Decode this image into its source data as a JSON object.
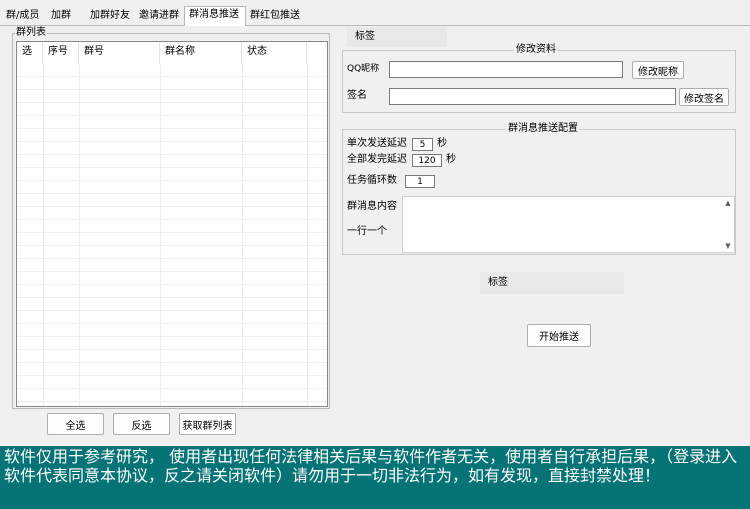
{
  "tabs": [
    {
      "label": "群/成员"
    },
    {
      "label": "加群"
    },
    {
      "label": "加群好友"
    },
    {
      "label": "邀请进群"
    },
    {
      "label": "群消息推送",
      "active": true
    },
    {
      "label": "群红包推送"
    }
  ],
  "group_list": {
    "title": "群列表",
    "columns": [
      "选",
      "序号",
      "群号",
      "群名称",
      "状态"
    ],
    "buttons": {
      "select_all": "全选",
      "invert": "反选",
      "fetch": "获取群列表"
    }
  },
  "right": {
    "tag_top": "标签",
    "profile": {
      "title": "修改资料",
      "nick_label": "QQ昵称",
      "nick_value": "",
      "nick_button": "修改昵称",
      "sign_label": "签名",
      "sign_value": "",
      "sign_button": "修改签名"
    },
    "config": {
      "title": "群消息推送配置",
      "single_delay_label": "单次发送延迟",
      "single_delay_value": "5",
      "single_delay_unit": "秒",
      "total_delay_label": "全部发完延迟",
      "total_delay_value": "120",
      "total_delay_unit": "秒",
      "loop_label": "任务循环数",
      "loop_value": "1",
      "content_label": "群消息内容",
      "content_hint": "一行一个",
      "content_value": ""
    },
    "tag_mid": "标签",
    "start_button": "开始推送"
  },
  "footer": {
    "text": "软件仅用于参考研究， 使用者出现任何法律相关后果与软件作者无关，使用者自行承担后果，（登录进入软件代表同意本协议，反之请关闭软件）请勿用于一切非法行为，如有发现，直接封禁处理！"
  }
}
